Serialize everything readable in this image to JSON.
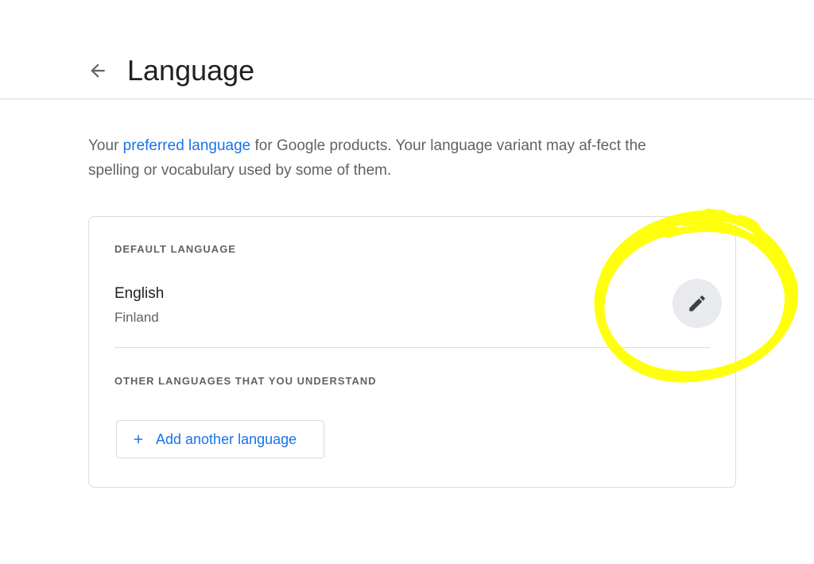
{
  "header": {
    "title": "Language",
    "back_icon": "arrow-back-icon"
  },
  "intro": {
    "text_before": "Your ",
    "link_text": "preferred language",
    "text_after": " for Google products. Your language variant may af-fect the spelling or vocabulary used by some of them."
  },
  "default_language": {
    "section_label": "DEFAULT LANGUAGE",
    "language": "English",
    "region": "Finland",
    "edit_icon": "pencil-icon"
  },
  "other_languages": {
    "section_label": "OTHER LANGUAGES THAT YOU UNDERSTAND",
    "add_button_label": "Add another language",
    "add_icon": "plus-icon"
  },
  "colors": {
    "link": "#1a73e8",
    "highlight_annotation": "#ffff00",
    "edit_button_bg": "#e8eaed",
    "border": "#dadce0"
  }
}
